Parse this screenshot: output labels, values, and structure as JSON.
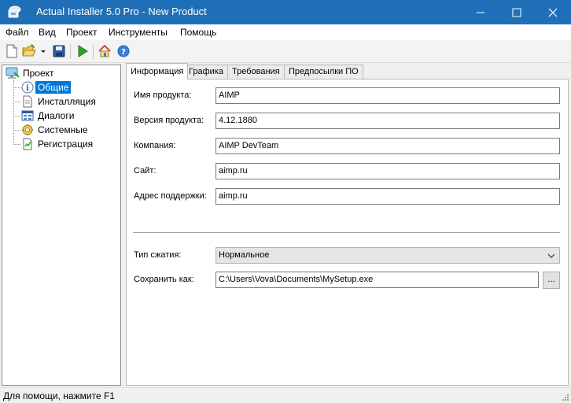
{
  "window": {
    "title": "Actual Installer 5.0 Pro - New Product",
    "title_bar_color": "#1f6fb8",
    "controls": [
      "minimize-icon",
      "maximize-icon",
      "close-icon"
    ]
  },
  "menu": {
    "items": [
      {
        "label": "Файл"
      },
      {
        "label": "Вид"
      },
      {
        "label": "Проект"
      },
      {
        "label": "Инструменты"
      },
      {
        "label": "Помощь"
      }
    ]
  },
  "toolbar": {
    "buttons": [
      "new-file-icon",
      "open-folder-icon",
      "save-icon",
      "run-icon",
      "home-icon",
      "help-icon"
    ]
  },
  "tree": {
    "root": {
      "label": "Проект",
      "icon": "project-icon"
    },
    "items": [
      {
        "label": "Общие",
        "icon": "info-icon",
        "selected": true
      },
      {
        "label": "Инсталляция",
        "icon": "document-icon",
        "selected": false
      },
      {
        "label": "Диалоги",
        "icon": "dialogs-icon",
        "selected": false
      },
      {
        "label": "Системные",
        "icon": "system-icon",
        "selected": false
      },
      {
        "label": "Регистрация",
        "icon": "registration-icon",
        "selected": false
      }
    ],
    "selection_color": "#0078d7"
  },
  "tabs": [
    {
      "label": "Информация",
      "active": true
    },
    {
      "label": "Графика",
      "active": false
    },
    {
      "label": "Требования",
      "active": false
    },
    {
      "label": "Предпосылки ПО",
      "active": false
    }
  ],
  "form": {
    "product_name": {
      "label": "Имя продукта:",
      "value": "AIMP"
    },
    "product_version": {
      "label": "Версия продукта:",
      "value": "4.12.1880"
    },
    "company": {
      "label": "Компания:",
      "value": "AIMP DevTeam"
    },
    "site": {
      "label": "Сайт:",
      "value": "aimp.ru"
    },
    "support_address": {
      "label": "Адрес поддержки:",
      "value": "aimp.ru"
    },
    "compression": {
      "label": "Тип сжатия:",
      "value": "Нормальное"
    },
    "save_as": {
      "label": "Сохранить как:",
      "value": "C:\\Users\\Vova\\Documents\\MySetup.exe",
      "browse_label": "..."
    }
  },
  "status": {
    "text": "Для помощи, нажмите F1"
  }
}
